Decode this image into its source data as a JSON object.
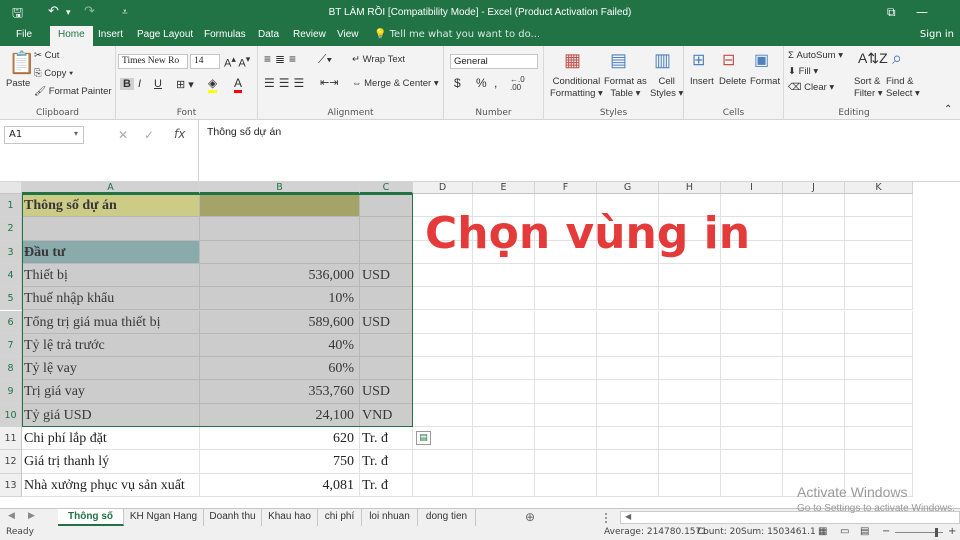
{
  "title": "BT LÀM RỒI  [Compatibility Mode] - Excel (Product Activation Failed)",
  "tabs": [
    "File",
    "Home",
    "Insert",
    "Page Layout",
    "Formulas",
    "Data",
    "Review",
    "View"
  ],
  "tell_me": "Tell me what you want to do...",
  "sign_in": "Sign in",
  "ribbon": {
    "clipboard": {
      "paste": "Paste",
      "cut": "Cut",
      "copy": "Copy",
      "format_painter": "Format Painter",
      "label": "Clipboard"
    },
    "font": {
      "name": "Times New Ro",
      "size": "14",
      "bold": "B",
      "italic": "I",
      "underline": "U",
      "label": "Font"
    },
    "alignment": {
      "wrap": "Wrap Text",
      "merge": "Merge & Center",
      "label": "Alignment"
    },
    "number": {
      "format": "General",
      "currency": "$",
      "percent": "%",
      "comma": ",",
      "label": "Number"
    },
    "styles": {
      "cond": "Conditional",
      "cond2": "Formatting",
      "fmt_table": "Format as",
      "fmt_table2": "Table",
      "cell_styles": "Cell",
      "cell_styles2": "Styles",
      "label": "Styles"
    },
    "cells": {
      "insert": "Insert",
      "delete": "Delete",
      "format": "Format",
      "label": "Cells"
    },
    "editing": {
      "autosum": "AutoSum",
      "fill": "Fill",
      "clear": "Clear",
      "sort": "Sort &",
      "sort2": "Filter",
      "find": "Find &",
      "find2": "Select",
      "label": "Editing"
    }
  },
  "name_box": "A1",
  "formula": "Thông số dự án",
  "columns": [
    "A",
    "B",
    "C",
    "D",
    "E",
    "F",
    "G",
    "H",
    "I",
    "J",
    "K"
  ],
  "rows": [
    {
      "n": "1",
      "a": "Thông số dự án",
      "b": "",
      "c": ""
    },
    {
      "n": "2",
      "a": "",
      "b": "",
      "c": ""
    },
    {
      "n": "3",
      "a": "Đầu tư",
      "b": "",
      "c": ""
    },
    {
      "n": "4",
      "a": "Thiết bị",
      "b": "536,000",
      "c": "USD"
    },
    {
      "n": "5",
      "a": "Thuế nhập khẩu",
      "b": "10%",
      "c": ""
    },
    {
      "n": "6",
      "a": "Tổng trị giá mua thiết bị",
      "b": "589,600",
      "c": "USD"
    },
    {
      "n": "7",
      "a": "Tỷ lệ trả trước",
      "b": "40%",
      "c": ""
    },
    {
      "n": "8",
      "a": "Tỷ lệ vay",
      "b": "60%",
      "c": ""
    },
    {
      "n": "9",
      "a": "Trị giá vay",
      "b": "353,760",
      "c": "USD"
    },
    {
      "n": "10",
      "a": "Tỷ giá USD",
      "b": "24,100",
      "c": "VND"
    },
    {
      "n": "11",
      "a": "Chi phí lắp đặt",
      "b": "620",
      "c": "Tr. đ"
    },
    {
      "n": "12",
      "a": "Giá trị thanh lý",
      "b": "750",
      "c": "Tr. đ"
    },
    {
      "n": "13",
      "a": "Nhà xưởng phục vụ sản xuất",
      "b": "4,081",
      "c": "Tr. đ"
    }
  ],
  "overlay_text": "Chọn vùng in",
  "sheets": [
    "Thông số",
    "KH Ngan Hang",
    "Doanh thu",
    "Khau hao",
    "chi phí",
    "loi nhuan",
    "dong tien"
  ],
  "status": {
    "ready": "Ready",
    "average": "Average: 214780.1571",
    "count": "Count: 20",
    "sum": "Sum: 1503461.1"
  },
  "watermark": {
    "line1": "Activate Windows",
    "line2": "Go to Settings to activate Windows."
  },
  "colors": {
    "excel_green": "#217346",
    "yellow": "#ffff99",
    "olive": "#c4c46a",
    "teal": "#9dcdd0",
    "red_text": "#e43a3a"
  }
}
